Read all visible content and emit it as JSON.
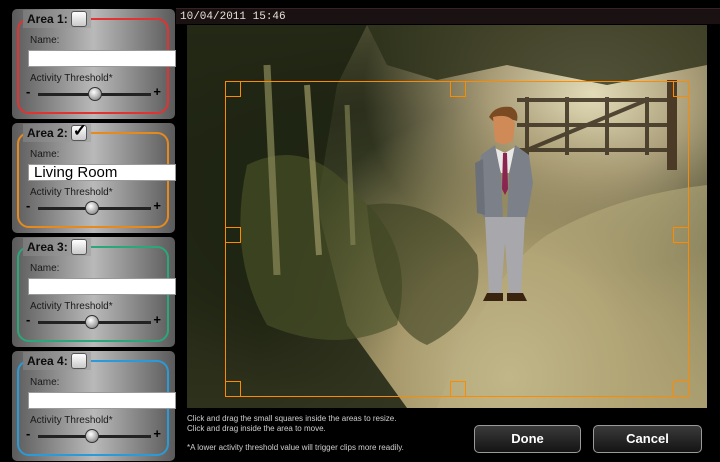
{
  "timestamp": "10/04/2011 15:46",
  "labels": {
    "name": "Name:",
    "threshold": "Activity Threshold*"
  },
  "areas": [
    {
      "title": "Area 1:",
      "checked": false,
      "name_value": "",
      "threshold": 0.5,
      "color": "#e23232"
    },
    {
      "title": "Area 2:",
      "checked": true,
      "name_value": "Living Room",
      "threshold": 0.48,
      "color": "#e68a1e"
    },
    {
      "title": "Area 3:",
      "checked": false,
      "name_value": "",
      "threshold": 0.48,
      "color": "#2aa87a"
    },
    {
      "title": "Area 4:",
      "checked": false,
      "name_value": "",
      "threshold": 0.48,
      "color": "#2a9ad8"
    }
  ],
  "slider_signs": {
    "minus": "-",
    "plus": "+"
  },
  "help": {
    "line1": "Click and drag the small squares inside the areas to resize.",
    "line2": "Click and drag inside the area to move.",
    "line3": "*A lower activity threshold value will trigger clips more readily."
  },
  "buttons": {
    "done": "Done",
    "cancel": "Cancel"
  },
  "selection_color": "#ff8a00"
}
